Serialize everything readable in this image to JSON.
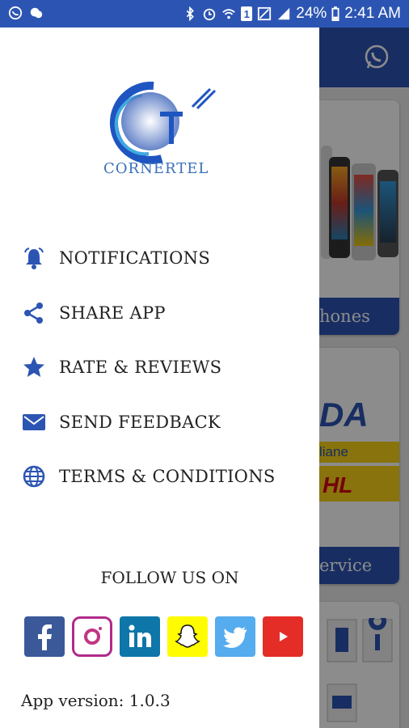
{
  "status_bar": {
    "battery": "24%",
    "time": "2:41 AM",
    "sim": "1"
  },
  "drawer": {
    "logo_text": "CORNERTEL",
    "menu": [
      {
        "label": "NOTIFICATIONS",
        "icon": "bell-icon"
      },
      {
        "label": "SHARE APP",
        "icon": "share-icon"
      },
      {
        "label": "RATE & REVIEWS",
        "icon": "star-icon"
      },
      {
        "label": "SEND FEEDBACK",
        "icon": "mail-icon"
      },
      {
        "label": "TERMS & CONDITIONS",
        "icon": "globe-icon"
      }
    ],
    "follow_label": "FOLLOW US ON",
    "social": [
      {
        "name": "facebook",
        "color": "#3b5998"
      },
      {
        "name": "instagram",
        "color": "#ffffff"
      },
      {
        "name": "linkedin",
        "color": "#0e76a8"
      },
      {
        "name": "snapchat",
        "color": "#fffc00"
      },
      {
        "name": "twitter",
        "color": "#55acee"
      },
      {
        "name": "youtube",
        "color": "#e52d27"
      }
    ],
    "version_label": "App version:  1.0.3"
  },
  "background": {
    "card1_label": "hones",
    "card2_text": "liane",
    "card3_label": "ervice"
  },
  "colors": {
    "primary": "#2c55b3",
    "icon": "#2c55b3"
  }
}
